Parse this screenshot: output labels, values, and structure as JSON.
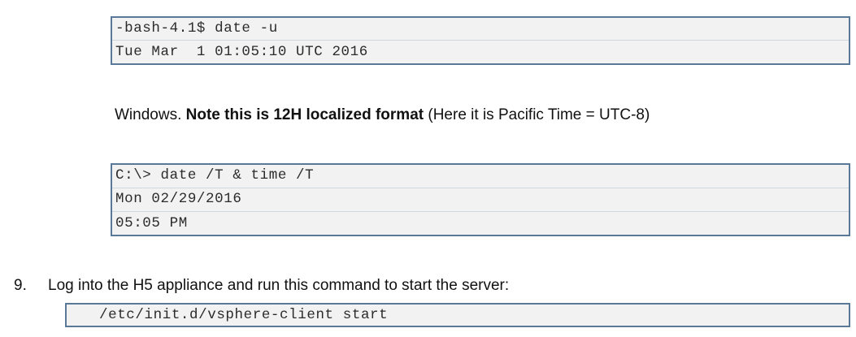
{
  "bash_block": {
    "lines": [
      "-bash-4.1$ date -u",
      "Tue Mar  1 01:05:10 UTC 2016"
    ]
  },
  "windows_note": {
    "prefix": "Windows. ",
    "bold": "Note this is 12H localized format",
    "suffix": " (Here it is Pacific Time = UTC-8)"
  },
  "windows_block": {
    "lines": [
      "C:\\> date /T & time /T",
      "Mon 02/29/2016",
      "05:05 PM"
    ]
  },
  "step": {
    "number": "9.",
    "text": "Log into the H5 appliance and run this command to start the server:"
  },
  "command_block": {
    "line": "/etc/init.d/vsphere-client start"
  }
}
